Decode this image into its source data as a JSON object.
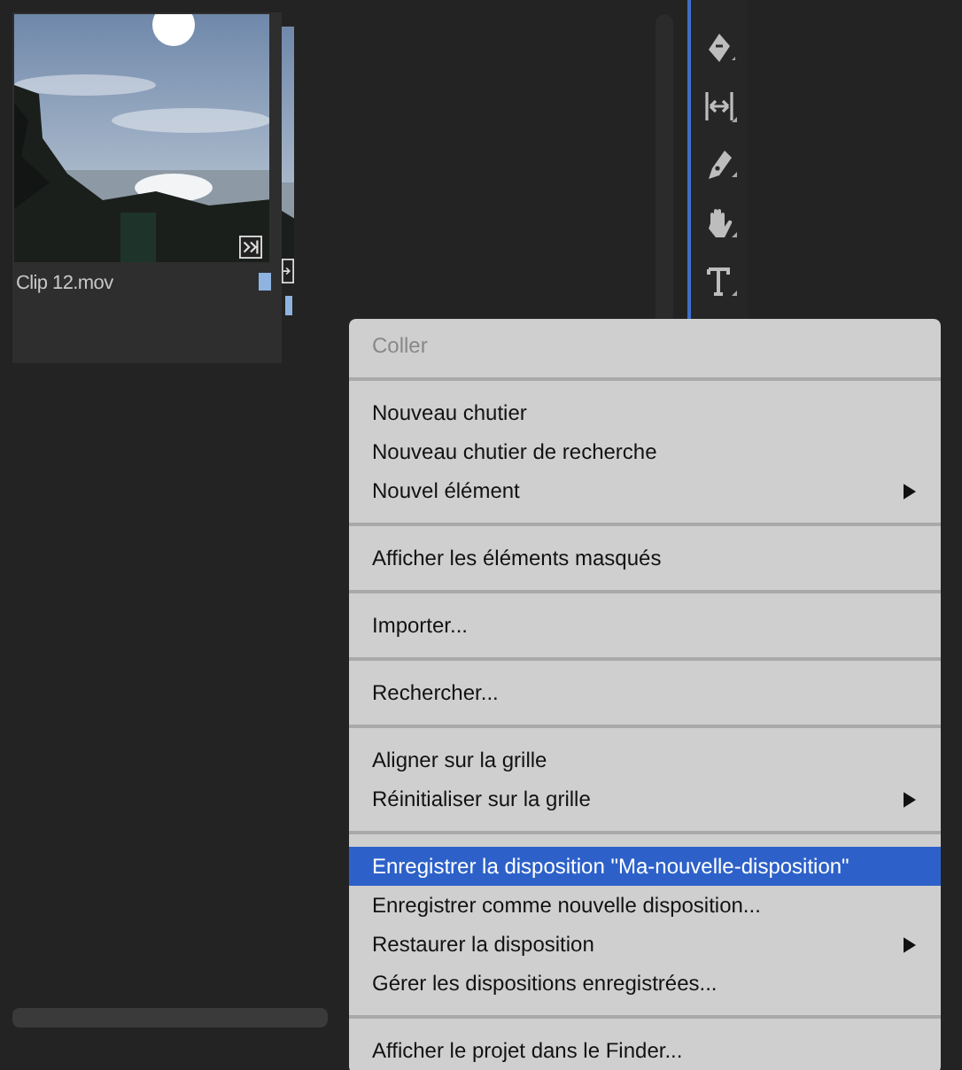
{
  "clip": {
    "name": "Clip 12.mov",
    "kind": "picture"
  },
  "context_menu": {
    "groups": [
      [
        {
          "label": "Coller",
          "disabled": true,
          "selected": false,
          "submenu": false
        }
      ],
      [
        {
          "label": "Nouveau chutier",
          "disabled": false,
          "selected": false,
          "submenu": false
        },
        {
          "label": "Nouveau chutier de recherche",
          "disabled": false,
          "selected": false,
          "submenu": false
        },
        {
          "label": "Nouvel élément",
          "disabled": false,
          "selected": false,
          "submenu": true
        }
      ],
      [
        {
          "label": "Afficher les éléments masqués",
          "disabled": false,
          "selected": false,
          "submenu": false
        }
      ],
      [
        {
          "label": "Importer...",
          "disabled": false,
          "selected": false,
          "submenu": false
        }
      ],
      [
        {
          "label": "Rechercher...",
          "disabled": false,
          "selected": false,
          "submenu": false
        }
      ],
      [
        {
          "label": "Aligner sur la grille",
          "disabled": false,
          "selected": false,
          "submenu": false
        },
        {
          "label": "Réinitialiser sur la grille",
          "disabled": false,
          "selected": false,
          "submenu": true
        }
      ],
      [
        {
          "label": "Enregistrer la disposition \"Ma-nouvelle-disposition\"",
          "disabled": false,
          "selected": true,
          "submenu": false
        },
        {
          "label": "Enregistrer comme nouvelle disposition...",
          "disabled": false,
          "selected": false,
          "submenu": false
        },
        {
          "label": "Restaurer la disposition",
          "disabled": false,
          "selected": false,
          "submenu": true
        },
        {
          "label": "Gérer les dispositions enregistrées...",
          "disabled": false,
          "selected": false,
          "submenu": false
        }
      ],
      [
        {
          "label": "Afficher le projet dans le Finder...",
          "disabled": false,
          "selected": false,
          "submenu": false
        }
      ]
    ]
  }
}
